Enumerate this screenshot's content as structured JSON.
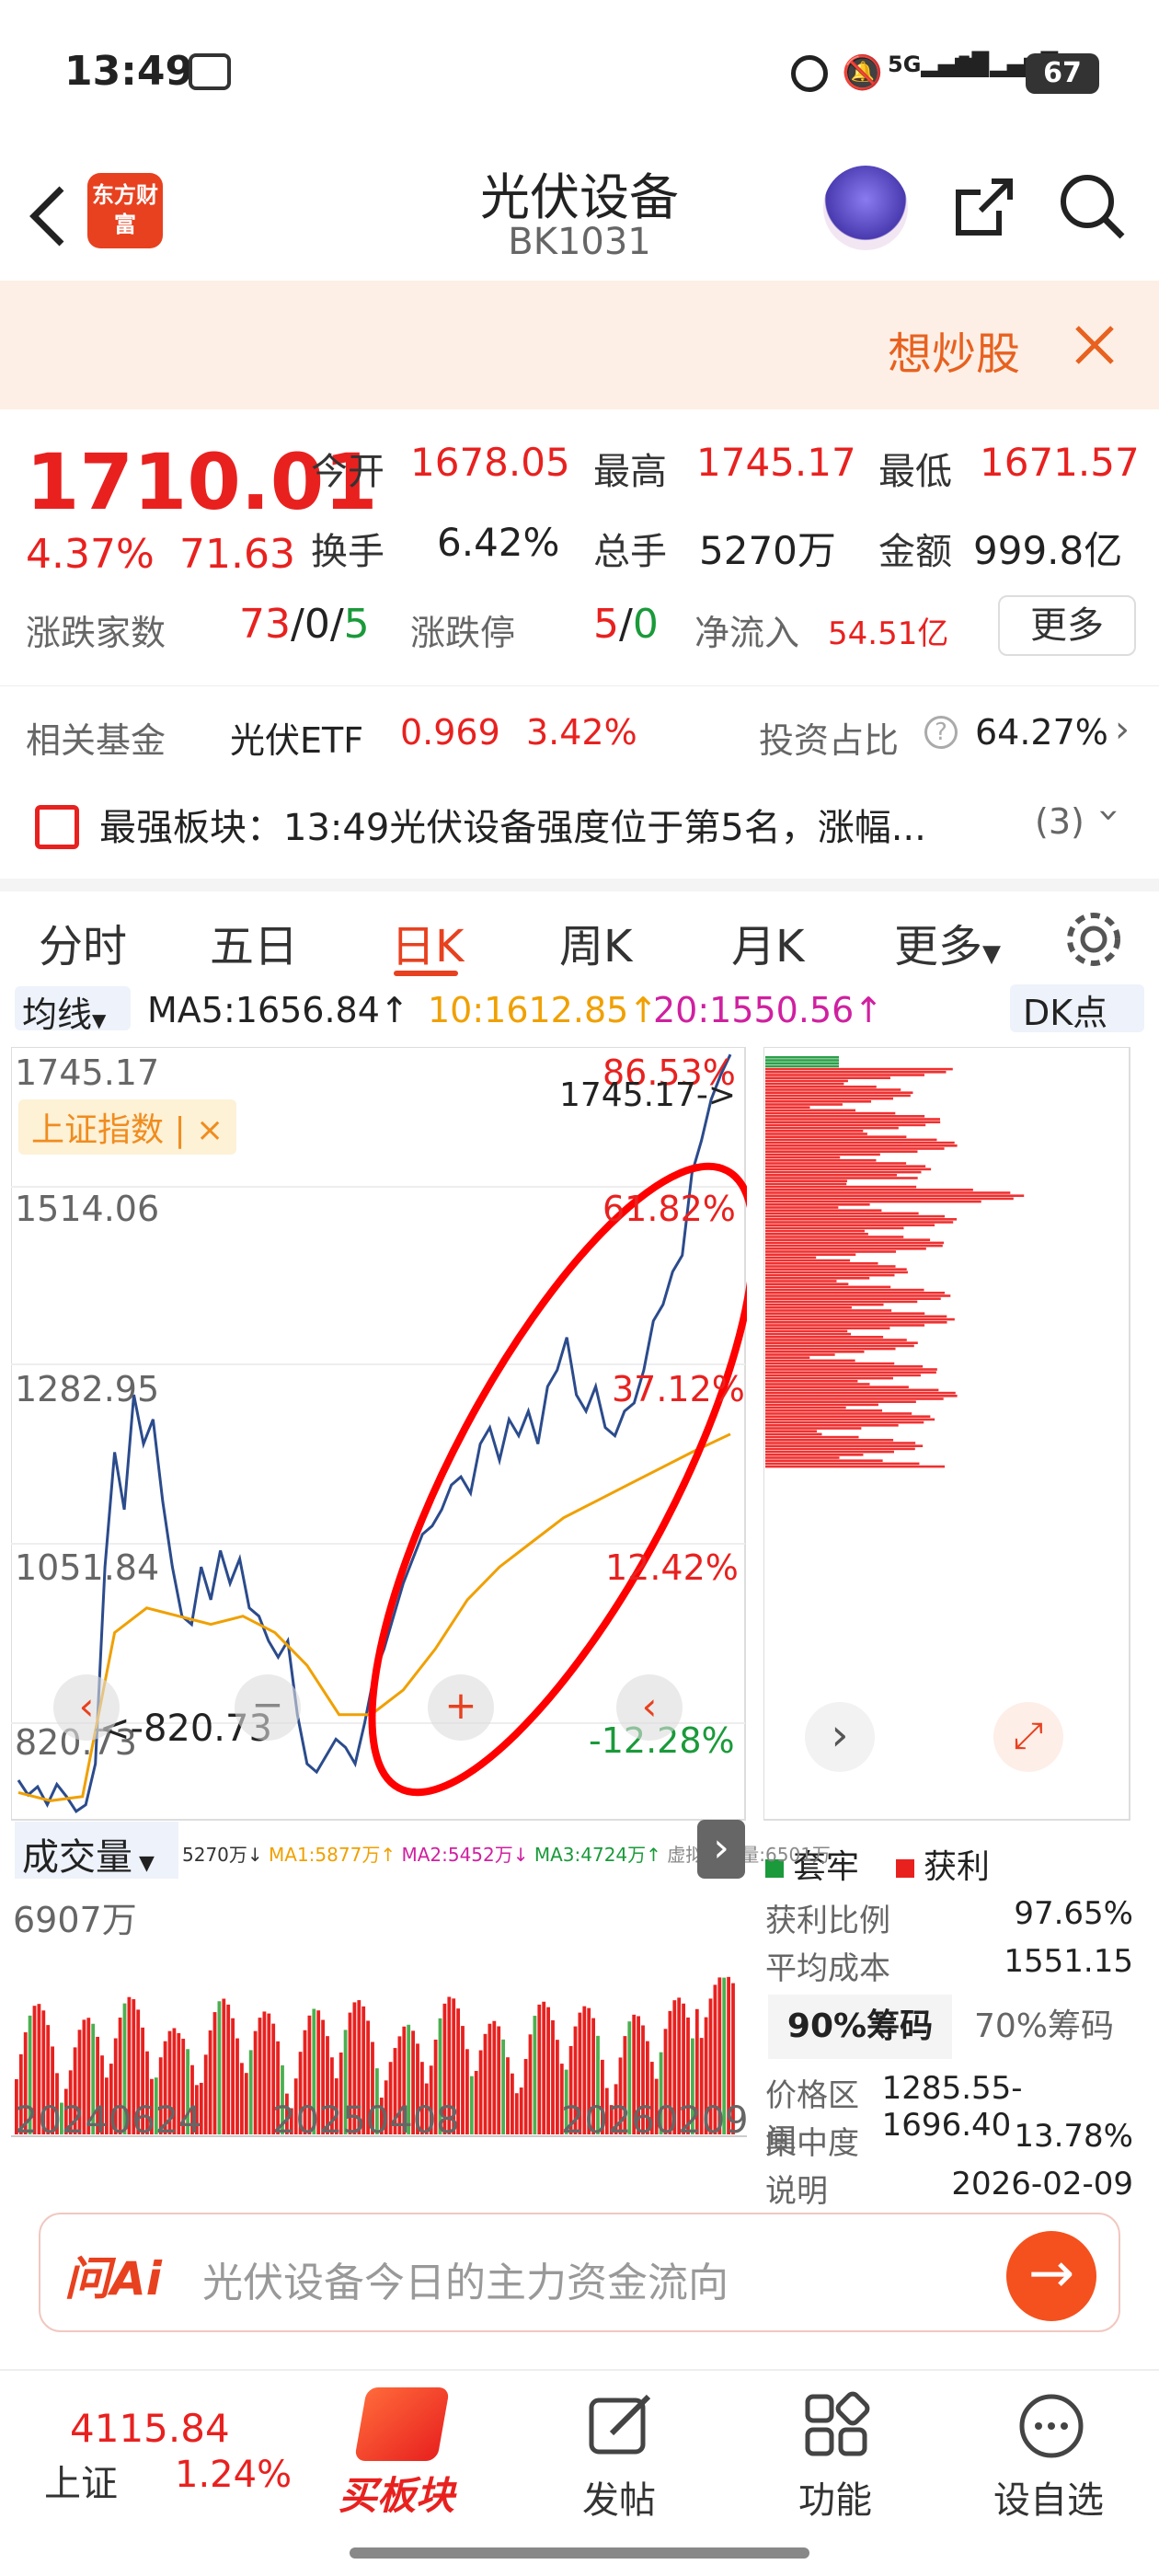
{
  "status_bar": {
    "time": "13:49",
    "battery": "67",
    "network1": "5G",
    "network2": "5G"
  },
  "header": {
    "title": "光伏设备",
    "code": "BK1031",
    "logo_text": "东方财富"
  },
  "banner": {
    "text": "想炒股"
  },
  "quote": {
    "price": "1710.01",
    "change_pct": "4.37%",
    "change": "71.63",
    "row1": [
      {
        "label": "今开",
        "value": "1678.05"
      },
      {
        "label": "最高",
        "value": "1745.17"
      },
      {
        "label": "最低",
        "value": "1671.57"
      }
    ],
    "row2": [
      {
        "label": "换手",
        "value": "6.42%"
      },
      {
        "label": "总手",
        "value": "5270万"
      },
      {
        "label": "金额",
        "value": "999.8亿"
      }
    ],
    "rise_fall_label": "涨跌家数",
    "rise": "73",
    "flat": "0",
    "fall": "5",
    "limit_label": "涨跌停",
    "limit_up": "5",
    "limit_down": "0",
    "netflow_label": "净流入",
    "netflow": "54.51亿",
    "more_label": "更多"
  },
  "fund": {
    "label": "相关基金",
    "name": "光伏ETF",
    "price": "0.969",
    "pct": "3.42%",
    "ratio_label": "投资占比",
    "ratio": "64.27%"
  },
  "strongest": {
    "text": "最强板块：13:49光伏设备强度位于第5名，涨幅...",
    "count": "(3)"
  },
  "tabs": [
    "分时",
    "五日",
    "日K",
    "周K",
    "月K",
    "更多"
  ],
  "active_tab": 2,
  "ma_bar": {
    "select": "均线",
    "ma5": "MA5:1656.84",
    "ma10": "10:1612.85",
    "ma20": "20:1550.56",
    "dk": "DK点"
  },
  "kline": {
    "y_labels": [
      "1745.17",
      "1514.06",
      "1282.95",
      "1051.84",
      "820.73"
    ],
    "pct_labels": [
      "86.53%",
      "61.82%",
      "37.12%",
      "12.42%",
      "-12.28%"
    ],
    "index_tag": "上证指数 | ×",
    "high_marker": "1745.17->",
    "low_marker": "<-820.73"
  },
  "volume": {
    "select": "成交量",
    "info": [
      {
        "text": "5270万↓",
        "color": "#333333"
      },
      {
        "text": "MA1:5877万↑",
        "color": "#f0a000"
      },
      {
        "text": "MA2:5452万↓",
        "color": "#d020a0"
      },
      {
        "text": "MA3:4724万↑",
        "color": "#1a9a3a"
      },
      {
        "text": "虚拟成交量:6501万",
        "color": "#888888"
      }
    ],
    "max_label": "6907万",
    "dates": [
      "20240624",
      "20250408",
      "20260209"
    ]
  },
  "chips": {
    "legend_trap": "套牢",
    "legend_profit": "获利",
    "rows1": [
      {
        "label": "获利比例",
        "value": "97.65%"
      },
      {
        "label": "平均成本",
        "value": "1551.15"
      }
    ],
    "tab90": "90%筹码",
    "tab70": "70%筹码",
    "rows2": [
      {
        "label": "价格区间",
        "value": "1285.55-1696.40"
      },
      {
        "label": "集中度",
        "value": "13.78%"
      },
      {
        "label": "说明",
        "value": "2026-02-09"
      }
    ]
  },
  "ask": {
    "logo": "问Ai",
    "placeholder": "光伏设备今日的主力资金流向"
  },
  "nav": {
    "index_value": "4115.84",
    "index_name": "上证",
    "index_pct": "1.24%",
    "buy_label": "买板块",
    "items": [
      "发帖",
      "功能",
      "设自选"
    ]
  },
  "colors": {
    "red": "#e8211f",
    "green": "#1a9a3a",
    "orange": "#f08c1e",
    "price_line": "#2b4b8c",
    "ma_line": "#f0a000",
    "banner_bg": "#fdefe6"
  },
  "chart_data": [
    {
      "type": "line",
      "title": "",
      "series": [
        {
          "name": "",
          "x": [
            0,
            6,
            12,
            18,
            24,
            30,
            36,
            42,
            48,
            54,
            60,
            66,
            72,
            78,
            84,
            90,
            96,
            102,
            108,
            114,
            120,
            126,
            132,
            138,
            144,
            150,
            156,
            162,
            168,
            174,
            180,
            186,
            192,
            198,
            204,
            210,
            216,
            222,
            228,
            234,
            240,
            246,
            252,
            258,
            264,
            270,
            276,
            282,
            288,
            294,
            300,
            306,
            312,
            318,
            324,
            330,
            336,
            342,
            348,
            354,
            360,
            366,
            372,
            378,
            384,
            390,
            396,
            402,
            408,
            414,
            420,
            426,
            432,
            438,
            444
          ],
          "values": [
            860,
            842,
            852,
            830,
            855,
            840,
            822,
            830,
            880,
            1120,
            1260,
            1190,
            1330,
            1270,
            1300,
            1200,
            1120,
            1060,
            1050,
            1120,
            1080,
            1140,
            1100,
            1130,
            1070,
            1060,
            1030,
            1010,
            1030,
            940,
            880,
            870,
            890,
            910,
            900,
            880,
            930,
            990,
            1020,
            1060,
            1100,
            1130,
            1160,
            1170,
            1190,
            1220,
            1230,
            1210,
            1270,
            1290,
            1250,
            1300,
            1280,
            1310,
            1270,
            1340,
            1360,
            1400,
            1330,
            1310,
            1340,
            1290,
            1280,
            1310,
            1320,
            1360,
            1420,
            1440,
            1480,
            1500,
            1600,
            1640,
            1690,
            1720,
            1745
          ]
        },
        {
          "name": "",
          "x": [
            0,
            20,
            40,
            60,
            80,
            100,
            120,
            140,
            160,
            180,
            200,
            220,
            240,
            260,
            280,
            300,
            320,
            340,
            360,
            380,
            400,
            420,
            444
          ],
          "values": [
            845,
            835,
            840,
            1040,
            1070,
            1060,
            1050,
            1060,
            1040,
            1000,
            940,
            940,
            970,
            1020,
            1080,
            1120,
            1150,
            1180,
            1200,
            1220,
            1240,
            1260,
            1282
          ]
        }
      ],
      "ylim": [
        820.73,
        1745.17
      ]
    }
  ]
}
